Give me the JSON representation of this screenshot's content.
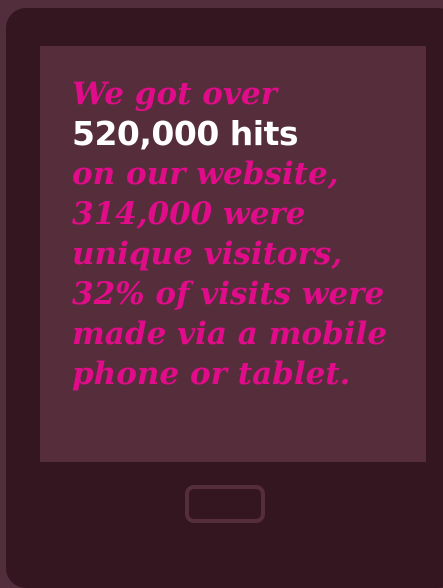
{
  "message": {
    "line1": "We got over",
    "line2": "520,000 hits",
    "line3": "on our website,",
    "line4": "314,000 were",
    "line5": "unique visitors,",
    "line6": "32% of visits were",
    "line7": "made via a mobile",
    "line8": "phone or tablet."
  },
  "colors": {
    "page_background": "#522d3b",
    "device_body": "#33161f",
    "screen": "#562d3b",
    "accent_text": "#e10c8a",
    "highlight_text": "#ffffff"
  },
  "icons": {
    "home_button": "home-button-icon"
  }
}
